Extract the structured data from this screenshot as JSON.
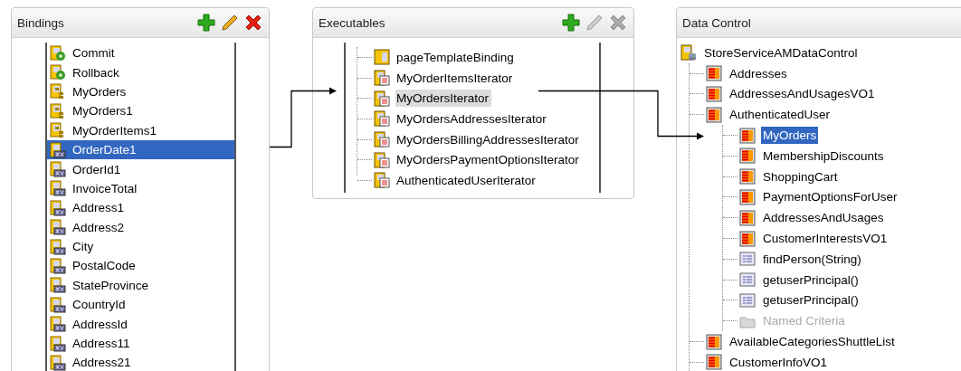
{
  "bindings": {
    "title": "Bindings",
    "toolbar": [
      {
        "kind": "add",
        "disabled": false
      },
      {
        "kind": "edit",
        "disabled": false
      },
      {
        "kind": "delete",
        "disabled": false
      }
    ],
    "items": [
      {
        "label": "Commit",
        "kind": "action",
        "selected": false
      },
      {
        "label": "Rollback",
        "kind": "action",
        "selected": false
      },
      {
        "label": "MyOrders",
        "kind": "tree",
        "selected": false
      },
      {
        "label": "MyOrders1",
        "kind": "tree",
        "selected": false
      },
      {
        "label": "MyOrderItems1",
        "kind": "tree",
        "selected": false
      },
      {
        "label": "OrderDate1",
        "kind": "attribute",
        "selected": true
      },
      {
        "label": "OrderId1",
        "kind": "attribute",
        "selected": false
      },
      {
        "label": "InvoiceTotal",
        "kind": "attribute",
        "selected": false
      },
      {
        "label": "Address1",
        "kind": "attribute",
        "selected": false
      },
      {
        "label": "Address2",
        "kind": "attribute",
        "selected": false
      },
      {
        "label": "City",
        "kind": "attribute",
        "selected": false
      },
      {
        "label": "PostalCode",
        "kind": "attribute",
        "selected": false
      },
      {
        "label": "StateProvince",
        "kind": "attribute",
        "selected": false
      },
      {
        "label": "CountryId",
        "kind": "attribute",
        "selected": false
      },
      {
        "label": "AddressId",
        "kind": "attribute",
        "selected": false
      },
      {
        "label": "Address11",
        "kind": "attribute",
        "selected": false
      },
      {
        "label": "Address21",
        "kind": "attribute",
        "selected": false
      }
    ]
  },
  "executables": {
    "title": "Executables",
    "toolbar": [
      {
        "kind": "add",
        "disabled": false
      },
      {
        "kind": "edit",
        "disabled": true
      },
      {
        "kind": "delete",
        "disabled": true
      }
    ],
    "items": [
      {
        "label": "pageTemplateBinding",
        "kind": "page",
        "selected": false
      },
      {
        "label": "MyOrderItemsIterator",
        "kind": "iterator",
        "selected": false
      },
      {
        "label": "MyOrdersIterator",
        "kind": "iterator",
        "selected": true
      },
      {
        "label": "MyOrdersAddressesIterator",
        "kind": "iterator",
        "selected": false
      },
      {
        "label": "MyOrdersBillingAddressesIterator",
        "kind": "iterator",
        "selected": false
      },
      {
        "label": "MyOrdersPaymentOptionsIterator",
        "kind": "iterator",
        "selected": false
      },
      {
        "label": "AuthenticatedUserIterator",
        "kind": "iterator",
        "selected": false
      }
    ]
  },
  "data_control": {
    "title": "Data Control",
    "tree": [
      {
        "label": "StoreServiceAMDataControl",
        "kind": "root",
        "selected": false,
        "disabled": false,
        "children": [
          {
            "label": "Addresses",
            "kind": "collection",
            "selected": false,
            "disabled": false
          },
          {
            "label": "AddressesAndUsagesVO1",
            "kind": "collection",
            "selected": false,
            "disabled": false
          },
          {
            "label": "AuthenticatedUser",
            "kind": "collection",
            "selected": false,
            "disabled": false,
            "children": [
              {
                "label": "MyOrders",
                "kind": "collection",
                "selected": true,
                "disabled": false
              },
              {
                "label": "MembershipDiscounts",
                "kind": "collection",
                "selected": false,
                "disabled": false
              },
              {
                "label": "ShoppingCart",
                "kind": "collection",
                "selected": false,
                "disabled": false
              },
              {
                "label": "PaymentOptionsForUser",
                "kind": "collection",
                "selected": false,
                "disabled": false
              },
              {
                "label": "AddressesAndUsages",
                "kind": "collection",
                "selected": false,
                "disabled": false
              },
              {
                "label": "CustomerInterestsVO1",
                "kind": "collection",
                "selected": false,
                "disabled": false
              },
              {
                "label": "findPerson(String)",
                "kind": "method",
                "selected": false,
                "disabled": false
              },
              {
                "label": "getuserPrincipal()",
                "kind": "method",
                "selected": false,
                "disabled": false
              },
              {
                "label": "getuserPrincipal()",
                "kind": "method",
                "selected": false,
                "disabled": false
              },
              {
                "label": "Named Criteria",
                "kind": "folder",
                "selected": false,
                "disabled": true
              }
            ]
          },
          {
            "label": "AvailableCategoriesShuttleList",
            "kind": "collection",
            "selected": false,
            "disabled": false
          },
          {
            "label": "CustomerInfoVO1",
            "kind": "collection",
            "selected": false,
            "disabled": false
          }
        ]
      }
    ]
  }
}
